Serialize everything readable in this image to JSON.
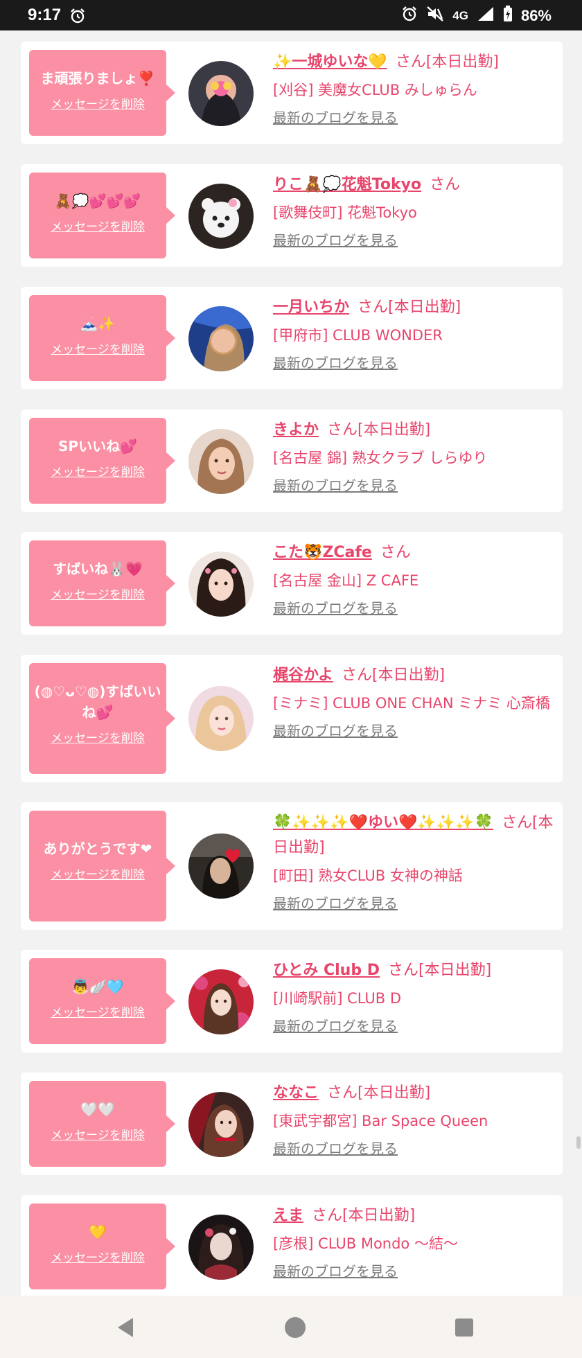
{
  "status_bar": {
    "time": "9:17",
    "network": "4G",
    "battery": "86%",
    "icons": [
      "alarm-icon",
      "mute-icon",
      "signal-icon",
      "battery-charging-icon"
    ]
  },
  "cards": [
    {
      "message": "ま頑張りましょ❣️",
      "delete_label": "メッセージを削除",
      "name": "✨一城ゆいな💛",
      "suffix": "さん[本日出勤]",
      "shop": "[刈谷] 美魔女CLUB みしゅらん",
      "blog_label": "最新のブログを見る"
    },
    {
      "message": "🧸💭💕💕💕",
      "delete_label": "メッセージを削除",
      "name": "りこ🧸💭花魁Tokyo",
      "suffix": "さん",
      "shop": "[歌舞伎町] 花魁Tokyo",
      "blog_label": "最新のブログを見る"
    },
    {
      "message": "🗻✨",
      "delete_label": "メッセージを削除",
      "name": "一月いちか",
      "suffix": "さん[本日出勤]",
      "shop": "[甲府市] CLUB WONDER",
      "blog_label": "最新のブログを見る"
    },
    {
      "message": "SPいいね💕",
      "delete_label": "メッセージを削除",
      "name": "きよか",
      "suffix": "さん[本日出勤]",
      "shop": "[名古屋 錦] 熟女クラブ しらゆり",
      "blog_label": "最新のブログを見る"
    },
    {
      "message": "すばいね🐰💗",
      "delete_label": "メッセージを削除",
      "name": "こた🐯ZCafe",
      "suffix": "さん",
      "shop": "[名古屋 金山] Z CAFE",
      "blog_label": "最新のブログを見る"
    },
    {
      "message": "(◍♡ᴗ♡◍)すばいいね💕",
      "delete_label": "メッセージを削除",
      "name": "梶谷かよ",
      "suffix": "さん[本日出勤]",
      "shop": "[ミナミ] CLUB ONE CHAN ミナミ 心斎橋",
      "blog_label": "最新のブログを見る"
    },
    {
      "message": "ありがとうです❤",
      "delete_label": "メッセージを削除",
      "name": "🍀✨✨✨❤️ゆい❤️✨✨✨🍀",
      "suffix": "さん[本日出勤]",
      "shop": "[町田] 熟女CLUB 女神の神話",
      "blog_label": "最新のブログを見る"
    },
    {
      "message": "👼🪽🩵",
      "delete_label": "メッセージを削除",
      "name": "ひとみ Club D",
      "suffix": "さん[本日出勤]",
      "shop": "[川崎駅前] CLUB D",
      "blog_label": "最新のブログを見る"
    },
    {
      "message": "🤍🤍",
      "delete_label": "メッセージを削除",
      "name": "ななこ",
      "suffix": "さん[本日出勤]",
      "shop": "[東武宇都宮] Bar Space Queen",
      "blog_label": "最新のブログを見る"
    },
    {
      "message": "💛",
      "delete_label": "メッセージを削除",
      "name": "えま",
      "suffix": "さん[本日出勤]",
      "shop": "[彦根] CLUB Mondo 〜結〜",
      "blog_label": "最新のブログを見る"
    }
  ],
  "nav": {
    "back_icon": "back-triangle-icon",
    "home_icon": "home-circle-icon",
    "recents_icon": "recents-square-icon"
  },
  "colors": {
    "accent_pink": "#fb8fa3",
    "name_pink": "#e8456b",
    "blog_gray": "#7b7b7b",
    "background": "#f2f2f2"
  }
}
